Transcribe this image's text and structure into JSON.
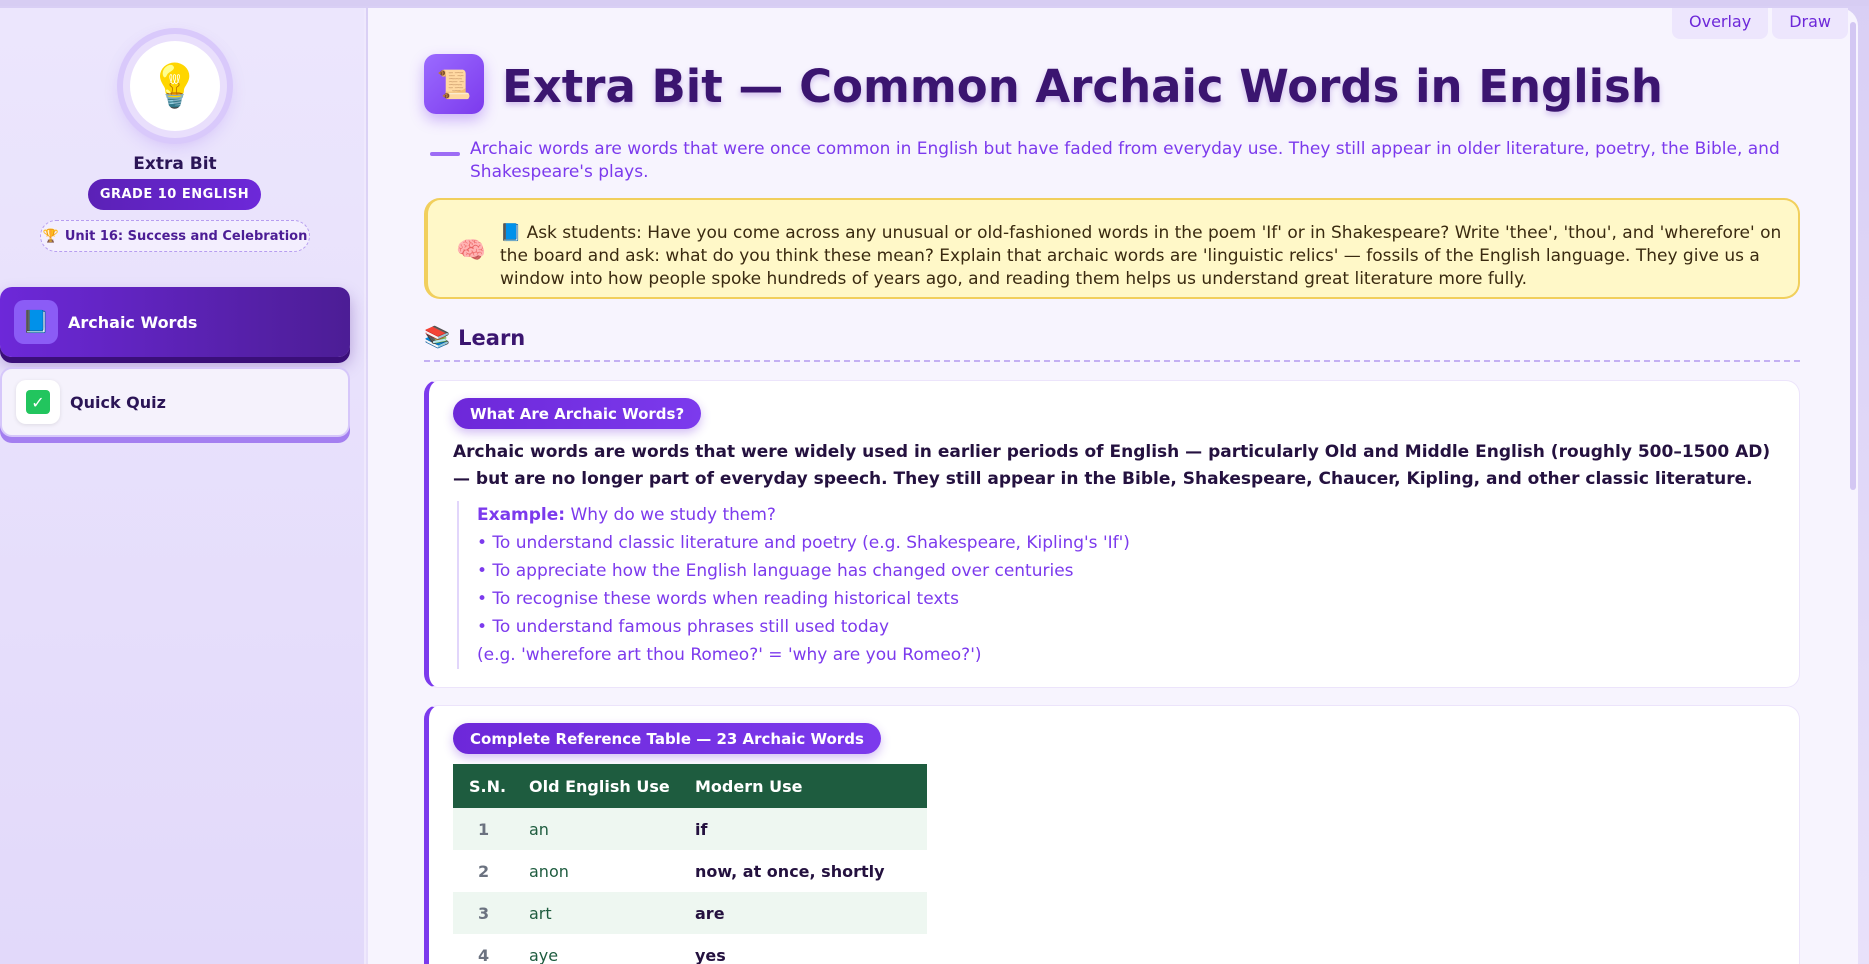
{
  "sidebar": {
    "logo_icon": "lightbulb-icon",
    "brand": "Extra Bit",
    "grade": "GRADE 10 ENGLISH",
    "unit": "Unit 16: Success and Celebration",
    "items": [
      {
        "label": "Archaic Words",
        "icon": "book-icon",
        "active": true
      },
      {
        "label": "Quick Quiz",
        "icon": "check-icon",
        "active": false
      }
    ]
  },
  "toolbar": {
    "overlay_label": "Overlay",
    "draw_label": "Draw"
  },
  "main": {
    "title": "Extra Bit — Common Archaic Words in English",
    "subtitle": "Archaic words are words that were once common in English but have faded from everyday use. They still appear in older literature, poetry, the Bible, and Shakespeare's plays.",
    "tip": "📘 Ask students: Have you come across any unusual or old-fashioned words in the poem 'If' or in Shakespeare? Write 'thee', 'thou', and 'wherefore' on the board and ask: what do you think these mean? Explain that archaic words are 'linguistic relics' — fossils of the English language. They give us a window into how people spoke hundreds of years ago, and reading them helps us understand great literature more fully.",
    "learn_heading": "Learn",
    "card1": {
      "heading": "What Are Archaic Words?",
      "body": "Archaic words are words that were widely used in earlier periods of English — particularly Old and Middle English (roughly 500–1500 AD) — but are no longer part of everyday speech. They still appear in the Bible, Shakespeare, Chaucer, Kipling, and other classic literature.",
      "example_label": "Example:",
      "example_question": "Why do we study them?",
      "points": [
        "• To understand classic literature and poetry (e.g. Shakespeare, Kipling's 'If')",
        "• To appreciate how the English language has changed over centuries",
        "• To recognise these words when reading historical texts",
        "• To understand famous phrases still used today",
        "(e.g. 'wherefore art thou Romeo?' = 'why are you Romeo?')"
      ]
    },
    "card2": {
      "heading": "Complete Reference Table — 23 Archaic Words",
      "columns": [
        "S.N.",
        "Old English Use",
        "Modern Use"
      ],
      "rows": [
        [
          "1",
          "an",
          "if"
        ],
        [
          "2",
          "anon",
          "now, at once, shortly"
        ],
        [
          "3",
          "art",
          "are"
        ],
        [
          "4",
          "aye",
          "yes"
        ]
      ]
    }
  },
  "colors": {
    "accent": "#7c3aed",
    "table_header": "#1e5c3f",
    "tip_bg": "#fff8c8"
  }
}
